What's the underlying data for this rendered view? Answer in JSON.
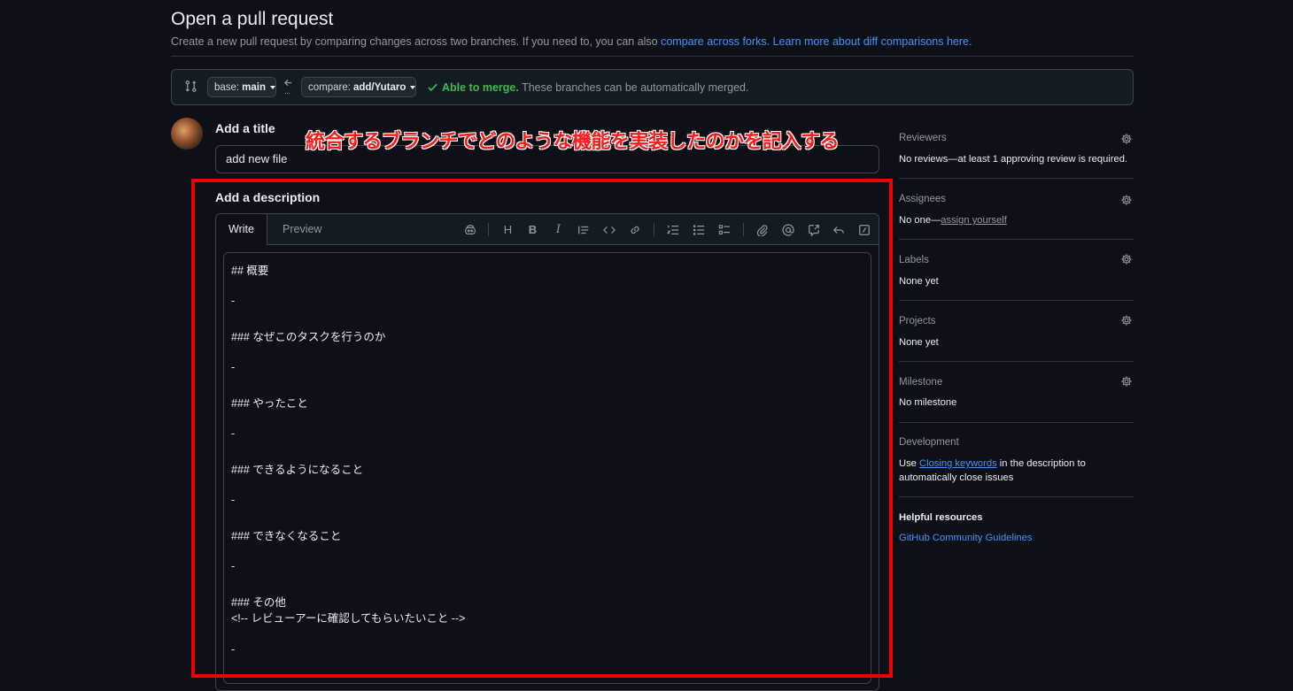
{
  "page": {
    "title": "Open a pull request",
    "subtitle_prefix": "Create a new pull request by comparing changes across two branches. If you need to, you can also ",
    "subtitle_link1": "compare across forks.",
    "subtitle_link2": "Learn more about diff comparisons here."
  },
  "compare": {
    "base_prefix": "base:",
    "base_branch": "main",
    "compare_prefix": "compare:",
    "compare_branch": "add/Yutaro",
    "merge_status": "Able to merge.",
    "merge_detail": "These branches can be automatically merged."
  },
  "form": {
    "title_label": "Add a title",
    "title_value": "add new file",
    "description_label": "Add a description",
    "tab_write": "Write",
    "tab_preview": "Preview",
    "description_lines": [
      "## 概要",
      "-",
      "### なぜこのタスクを行うのか",
      "-",
      "### やったこと",
      "-",
      "### できるようになること",
      "-",
      "### できなくなること",
      "-",
      "### その他",
      "<!-- レビューアーに確認してもらいたいこと -->",
      "-"
    ]
  },
  "annotation": {
    "text": "統合するブランチでどのような機能を実装したのかを記入する",
    "color": "#ff1a1a"
  },
  "sidebar": {
    "reviewers_label": "Reviewers",
    "reviewers_value": "No reviews—at least 1 approving review is required.",
    "assignees_label": "Assignees",
    "assignees_prefix": "No one—",
    "assignees_link": "assign yourself",
    "labels_label": "Labels",
    "labels_value": "None yet",
    "projects_label": "Projects",
    "projects_value": "None yet",
    "milestone_label": "Milestone",
    "milestone_value": "No milestone",
    "development_label": "Development",
    "development_prefix": "Use ",
    "development_link": "Closing keywords",
    "development_suffix": " in the description to",
    "development_line2": "automatically close issues",
    "helpful_label": "Helpful resources",
    "helpful_link": "GitHub Community Guidelines"
  },
  "colors": {
    "background": "#0d1117",
    "link": "#4493f8",
    "success": "#3fb950",
    "highlight_border": "#ee0000"
  }
}
